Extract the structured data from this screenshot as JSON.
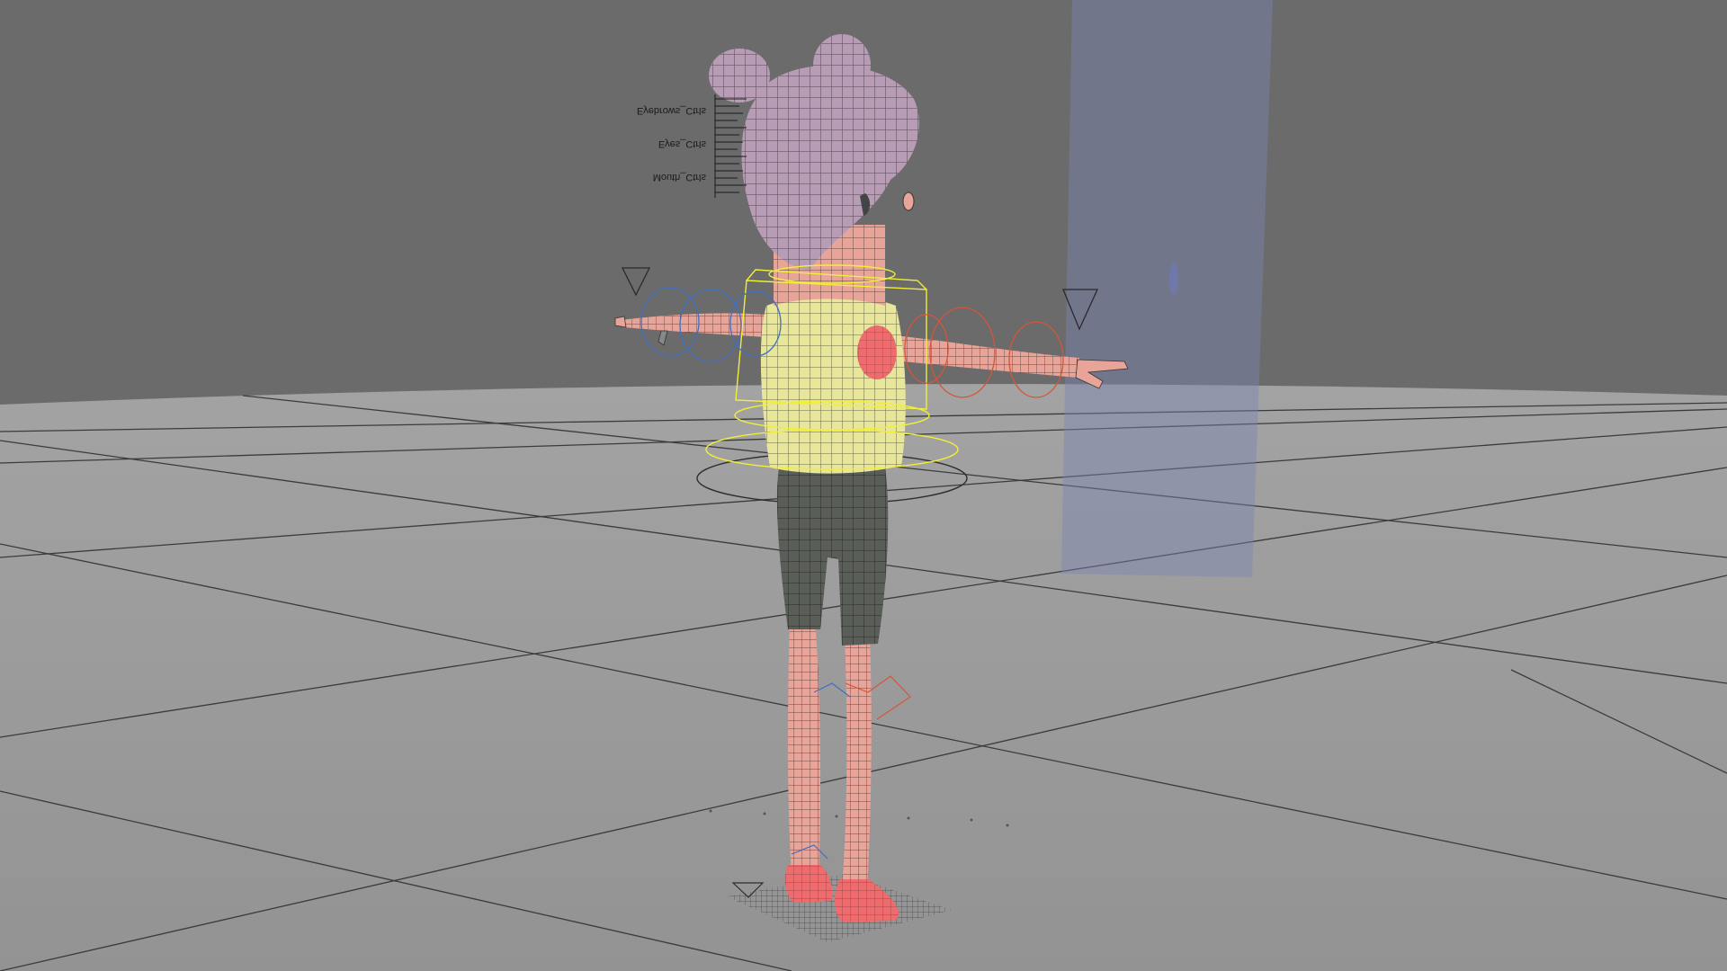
{
  "viewport": {
    "name": "3D perspective viewport",
    "background": "#6b6b6b",
    "floor_color": "#9a9a9a",
    "grid_color": "#3a3a3a"
  },
  "character": {
    "pose": "T-pose",
    "hair_color": "#b89cb6",
    "skin_color": "#e8a498",
    "shirt_color": "#e7e69a",
    "shorts_color": "#5a5e58",
    "foot_color": "#ee6c6e"
  },
  "controls": {
    "labels": [
      "Eyebrows_Ctrls",
      "Eyes_Ctrls",
      "Mouth_Ctrls"
    ],
    "fk_left_color": "#3e6fc4",
    "fk_right_color": "#d3563a",
    "torso_color": "#f1ee3a",
    "root_color": "#303030"
  },
  "light_plane_color": "#7c86b4"
}
